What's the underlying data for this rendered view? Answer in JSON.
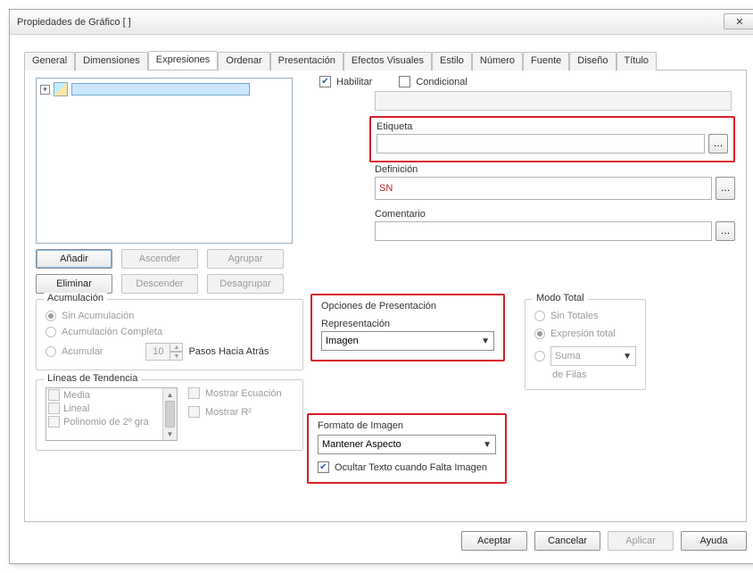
{
  "window": {
    "title": "Propiedades de Gráfico [ ]"
  },
  "tabs": [
    "General",
    "Dimensiones",
    "Expresiones",
    "Ordenar",
    "Presentación",
    "Efectos Visuales",
    "Estilo",
    "Número",
    "Fuente",
    "Diseño",
    "Título"
  ],
  "activeTab": "Expresiones",
  "top": {
    "habilitar": "Habilitar",
    "condicional": "Condicional",
    "etiqueta": "Etiqueta",
    "definicion": "Definición",
    "definicion_val": "SN",
    "comentario": "Comentario"
  },
  "buttons": {
    "add": "Añadir",
    "asc": "Ascender",
    "group": "Agrupar",
    "del": "Eliminar",
    "desc": "Descender",
    "ungroup": "Desagrupar"
  },
  "acum": {
    "title": "Acumulación",
    "none": "Sin Acumulación",
    "full": "Acumulación Completa",
    "part": "Acumular",
    "steps_val": "10",
    "steps_lbl": "Pasos Hacia Atrás"
  },
  "trend": {
    "title": "Líneas de Tendencia",
    "items": [
      "Media",
      "Lineal",
      "Polinomio de 2º gra"
    ],
    "show_eq": "Mostrar Ecuación",
    "show_r2": "Mostrar R²"
  },
  "pres": {
    "title": "Opciones de Presentación",
    "repr_lbl": "Representación",
    "repr_val": "Imagen"
  },
  "imgfmt": {
    "title": "Formato de Imagen",
    "val": "Mantener Aspecto",
    "hide_text": "Ocultar Texto cuando Falta Imagen"
  },
  "total": {
    "title": "Modo Total",
    "none": "Sin Totales",
    "expr": "Expresión total",
    "combo": "Suma",
    "rows": "de Filas"
  },
  "footer": {
    "ok": "Aceptar",
    "cancel": "Cancelar",
    "apply": "Aplicar",
    "help": "Ayuda"
  }
}
